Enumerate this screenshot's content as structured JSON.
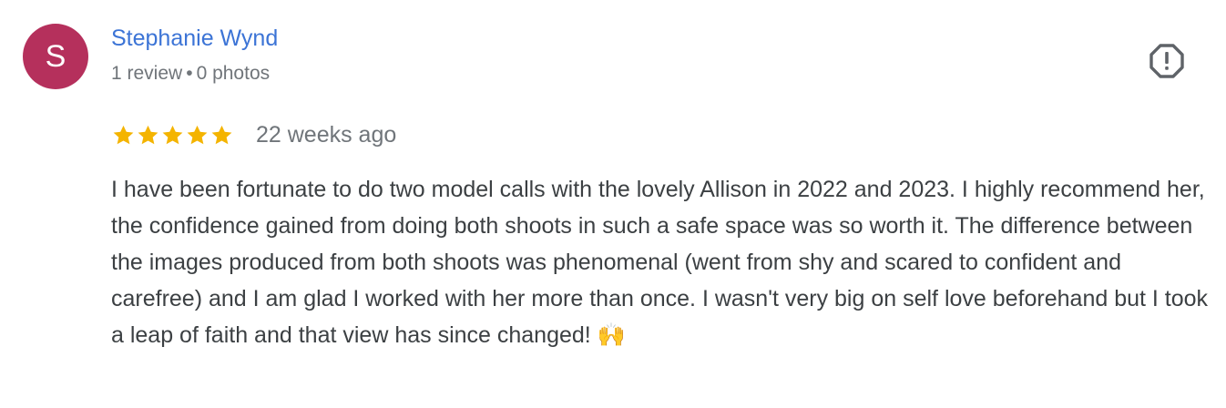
{
  "review": {
    "avatar_letter": "S",
    "avatar_color": "#b5305c",
    "author_name": "Stephanie Wynd",
    "review_count": "1 review",
    "meta_separator": "•",
    "photo_count": "0 photos",
    "rating": 5,
    "rating_max": 5,
    "star_color": "#f4b400",
    "time_ago": "22 weeks ago",
    "text": "I have been fortunate to do two model calls with the lovely Allison in 2022 and 2023. I highly recommend her, the confidence gained from doing both shoots in such a safe space was so worth it. The difference between the images produced from both shoots was phenomenal (went from shy and scared to confident and carefree) and I am glad I worked with her more than once. I wasn't very big on self love beforehand but I took a leap of faith and that view has since changed! 🙌",
    "report_icon": "report-flag-icon"
  }
}
